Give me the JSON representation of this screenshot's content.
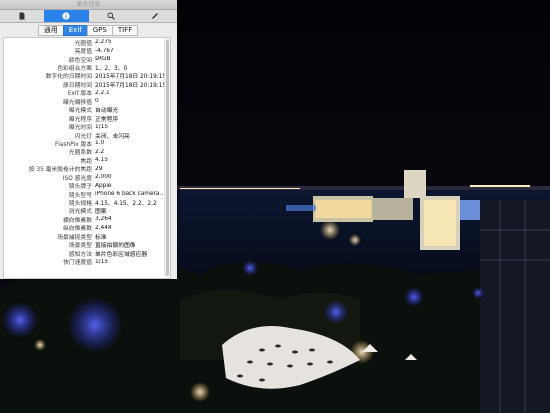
{
  "window": {
    "title": "更多信息"
  },
  "toolbar": {
    "items": [
      {
        "name": "file"
      },
      {
        "name": "info",
        "active": true
      },
      {
        "name": "search"
      },
      {
        "name": "pen"
      }
    ]
  },
  "tabs": [
    {
      "label": "通用",
      "active": false
    },
    {
      "label": "Exif",
      "active": true
    },
    {
      "label": "GPS",
      "active": false
    },
    {
      "label": "TIFF",
      "active": false
    }
  ],
  "exif": [
    {
      "k": "光圈值",
      "v": "2.275"
    },
    {
      "k": "亮度值",
      "v": "-4.767"
    },
    {
      "k": "颜色空间",
      "v": "sRGB"
    },
    {
      "k": "色彩组合方案",
      "v": "1、2、3、0"
    },
    {
      "k": "数字化的日期时间",
      "v": "2015年7月18日 20:19:15"
    },
    {
      "k": "原日期时间",
      "v": "2015年7月18日 20:19:15"
    },
    {
      "k": "Exif 版本",
      "v": "2.2.1"
    },
    {
      "k": "曝光偏移值",
      "v": "0"
    },
    {
      "k": "曝光模式",
      "v": "自动曝光"
    },
    {
      "k": "曝光程序",
      "v": "正常程序"
    },
    {
      "k": "曝光时间",
      "v": "1/15"
    },
    {
      "k": "闪光灯",
      "v": "关闭、未闪亮"
    },
    {
      "k": "FlashPix 版本",
      "v": "1.0"
    },
    {
      "k": "光圈系数",
      "v": "2.2"
    },
    {
      "k": "焦距",
      "v": "4.15"
    },
    {
      "k": "按 35 毫米胶卷计的焦距",
      "v": "29"
    },
    {
      "k": "ISO 感光度",
      "v": "2,000"
    },
    {
      "k": "镜头牌子",
      "v": "Apple"
    },
    {
      "k": "镜头型号",
      "v": "iPhone 6 back camera…"
    },
    {
      "k": "镜头规格",
      "v": "4.15、4.15、2.2、2.2"
    },
    {
      "k": "测光模式",
      "v": "图案"
    },
    {
      "k": "横向像素数",
      "v": "3,264"
    },
    {
      "k": "纵向像素数",
      "v": "2,448"
    },
    {
      "k": "场景捕捉类型",
      "v": "标准"
    },
    {
      "k": "场景类型",
      "v": "直接拍摄的图像"
    },
    {
      "k": "感知方法",
      "v": "单片色彩区域感应器"
    },
    {
      "k": "快门速度值",
      "v": "1/15"
    }
  ],
  "colors": {
    "accent": "#2f84e6"
  }
}
